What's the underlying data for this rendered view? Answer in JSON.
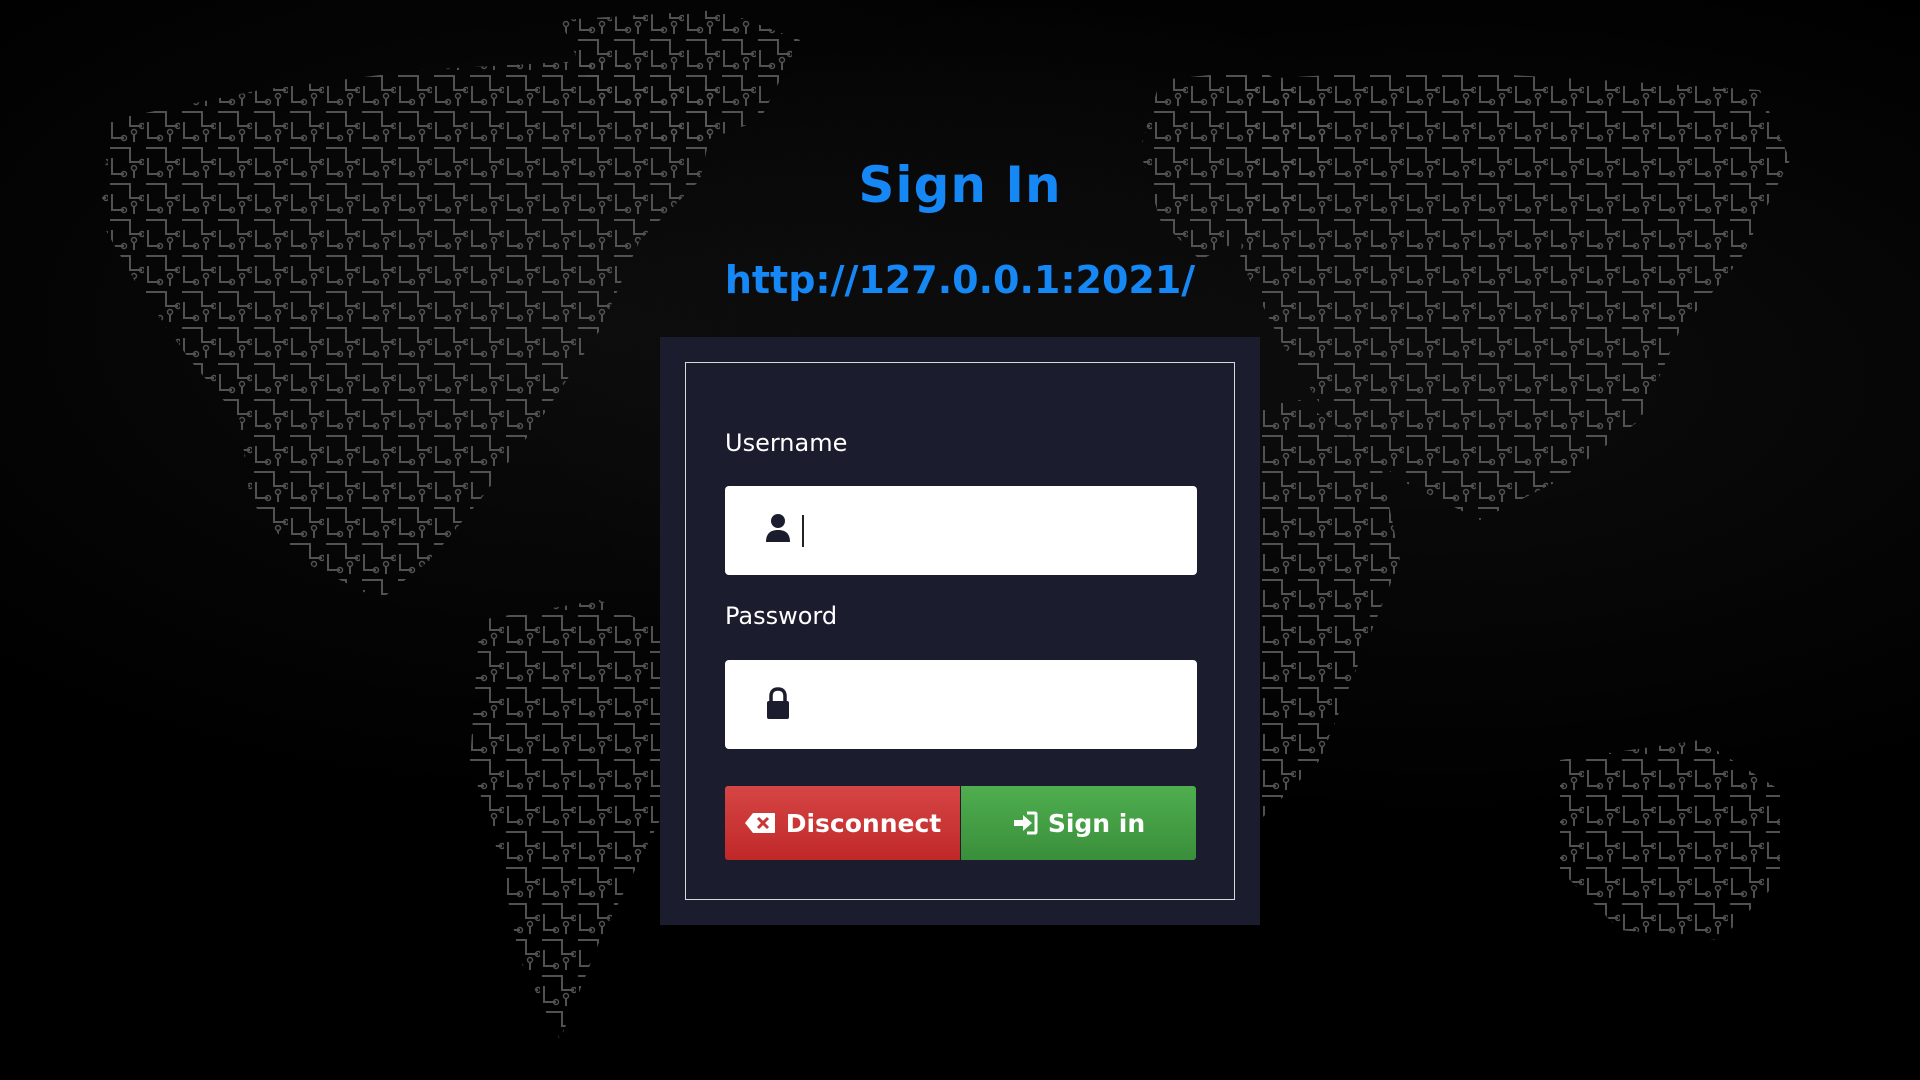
{
  "page": {
    "title": "Sign In",
    "url": "http://127.0.0.1:2021/"
  },
  "form": {
    "username_label": "Username",
    "username_value": "",
    "password_label": "Password",
    "password_value": "",
    "disconnect_label": "Disconnect",
    "signin_label": "Sign in"
  },
  "icons": {
    "username": "user-icon",
    "password": "lock-icon",
    "disconnect": "backspace-x-icon",
    "signin": "sign-in-arrow-icon"
  },
  "colors": {
    "accent": "#1688f5",
    "panel": "#1b1c2e",
    "disconnect": "#c93636",
    "signin": "#46a346"
  }
}
